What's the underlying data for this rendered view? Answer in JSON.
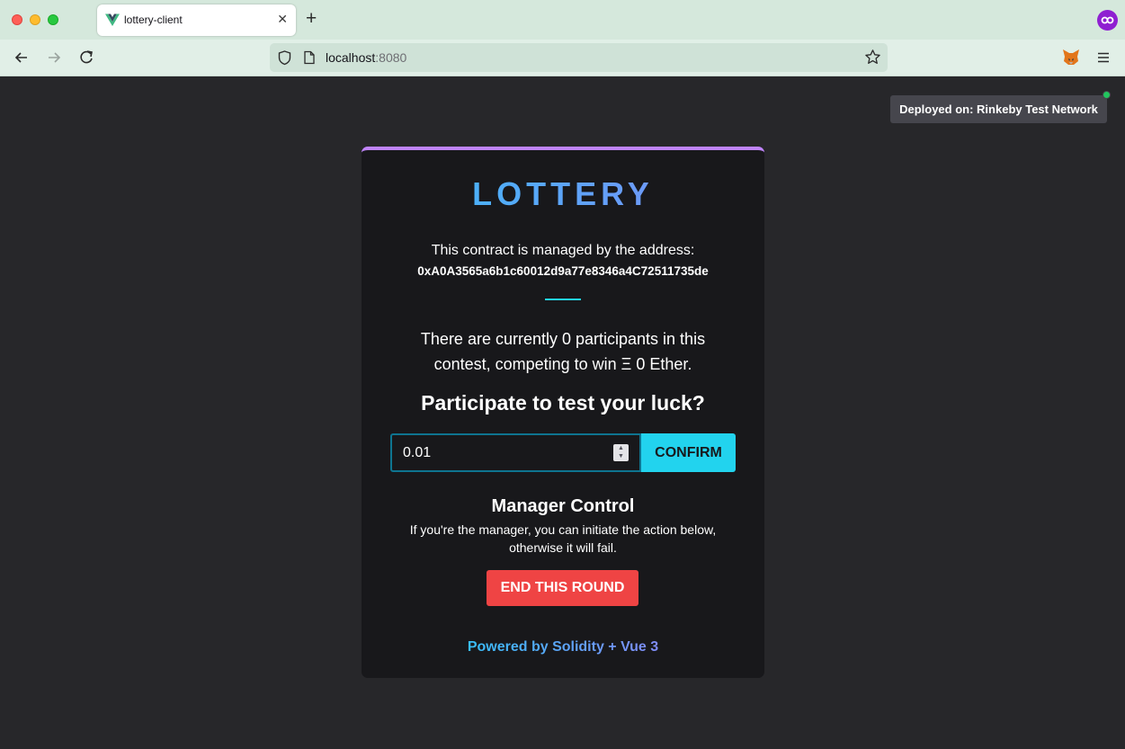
{
  "browser": {
    "tab_title": "lottery-client",
    "url_host": "localhost",
    "url_port": ":8080",
    "icons": [
      "back-icon",
      "forward-icon",
      "reload-icon",
      "shield-icon",
      "page-icon",
      "star-icon",
      "metamask-fox-icon",
      "menu-icon",
      "close-icon",
      "plus-icon",
      "profile-icon"
    ]
  },
  "network": {
    "label": "Deployed on: Rinkeby Test Network",
    "status_color": "#22c55e"
  },
  "card": {
    "title": "LOTTERY",
    "manager_line": "This contract is managed by the address:",
    "manager_address": "0xA0A3565a6b1c60012d9a77e8346a4C72511735de",
    "participants_text": "There are currently 0 participants in this contest, competing to win Ξ 0 Ether.",
    "participate_heading": "Participate to test your luck?",
    "amount_value": "0.01",
    "confirm_label": "CONFIRM",
    "manager_heading": "Manager Control",
    "manager_desc": "If you're the manager, you can initiate the action below, otherwise it will fail.",
    "end_label": "END THIS ROUND",
    "footer": "Powered by Solidity + Vue 3"
  },
  "colors": {
    "accent_cyan": "#22d3ee",
    "danger_red": "#ef4444",
    "card_top_border": "#c084fc"
  }
}
